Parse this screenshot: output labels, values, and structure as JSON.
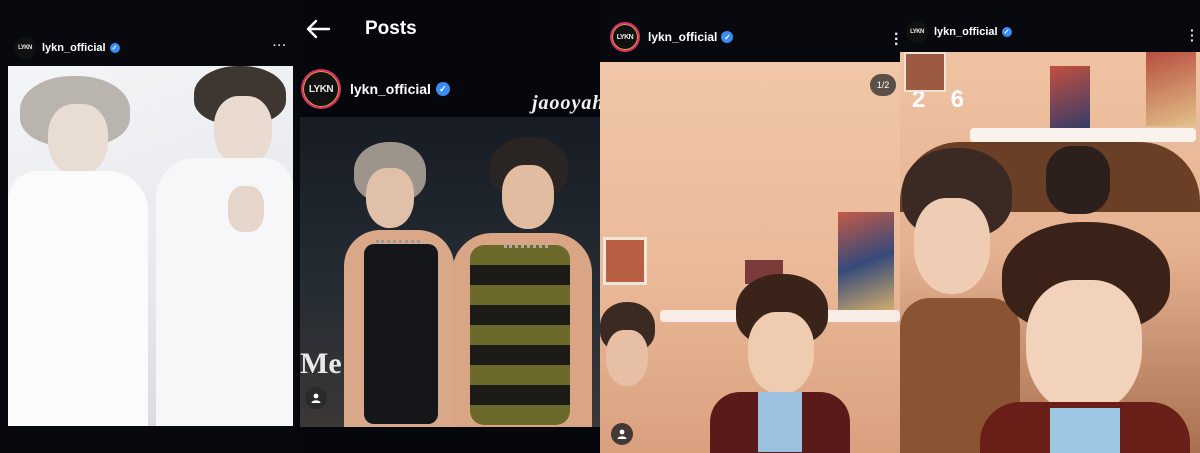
{
  "panel1": {
    "username": "lykn_official",
    "avatar_text": "LYKN",
    "more": "···"
  },
  "panel2": {
    "back_icon": "arrow-left-icon",
    "title": "Posts",
    "username": "lykn_official",
    "avatar_text": "LYKN",
    "overlay_text": "Me"
  },
  "panel3": {
    "username": "lykn_official",
    "avatar_text": "LYKN",
    "page_counter": "1/2",
    "watermark": "jaooyahh"
  },
  "panel4": {
    "username": "lykn_official",
    "avatar_text": "LYKN",
    "overlay_digits": "2  6"
  },
  "colors": {
    "verified": "#3a8cf5",
    "background": "#06080f",
    "avatar_ring": "#d9306b"
  }
}
